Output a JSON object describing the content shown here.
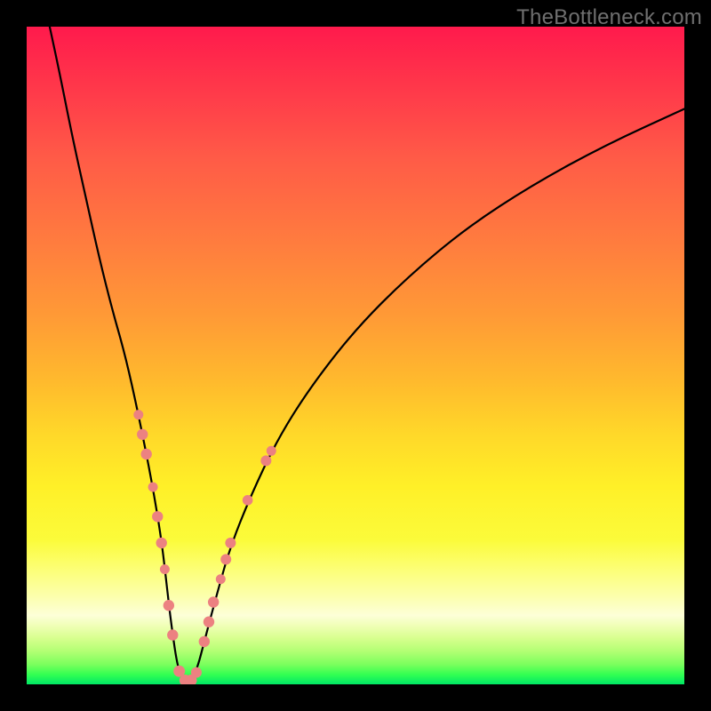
{
  "watermark": "TheBottleneck.com",
  "colors": {
    "frame": "#000000",
    "curve": "#000000",
    "marker_fill": "#ec8181",
    "marker_stroke": "#ec8181"
  },
  "chart_data": {
    "type": "line",
    "title": "",
    "xlabel": "",
    "ylabel": "",
    "xlim": [
      0,
      100
    ],
    "ylim": [
      0,
      100
    ],
    "grid": false,
    "legend": false,
    "series": [
      {
        "name": "bottleneck-curve",
        "x": [
          3.5,
          5,
          7,
          9,
          11,
          13,
          15,
          17,
          19,
          20.5,
          21.3,
          22,
          23,
          24,
          25,
          26,
          27,
          29,
          31,
          34,
          38,
          43,
          50,
          58,
          67,
          77,
          88,
          100
        ],
        "y": [
          100,
          93,
          83,
          74,
          65,
          57,
          50,
          41,
          31,
          22,
          15,
          9,
          2.2,
          0.6,
          0.6,
          2.6,
          6.5,
          14,
          21,
          28.5,
          37,
          45,
          54,
          62,
          69.5,
          76,
          82,
          87.5
        ]
      }
    ],
    "markers": [
      {
        "x": 17.0,
        "y": 41.0,
        "r": 5.5
      },
      {
        "x": 17.6,
        "y": 38.0,
        "r": 6.2
      },
      {
        "x": 18.2,
        "y": 35.0,
        "r": 6.2
      },
      {
        "x": 19.2,
        "y": 30.0,
        "r": 5.5
      },
      {
        "x": 19.9,
        "y": 25.5,
        "r": 6.2
      },
      {
        "x": 20.5,
        "y": 21.5,
        "r": 6.2
      },
      {
        "x": 21.0,
        "y": 17.5,
        "r": 5.5
      },
      {
        "x": 21.6,
        "y": 12.0,
        "r": 6.2
      },
      {
        "x": 22.2,
        "y": 7.5,
        "r": 6.2
      },
      {
        "x": 23.2,
        "y": 2.0,
        "r": 6.5
      },
      {
        "x": 24.1,
        "y": 0.6,
        "r": 6.5
      },
      {
        "x": 25.0,
        "y": 0.6,
        "r": 6.5
      },
      {
        "x": 25.8,
        "y": 1.8,
        "r": 6.0
      },
      {
        "x": 27.0,
        "y": 6.5,
        "r": 6.2
      },
      {
        "x": 27.7,
        "y": 9.5,
        "r": 6.2
      },
      {
        "x": 28.4,
        "y": 12.5,
        "r": 6.2
      },
      {
        "x": 29.5,
        "y": 16.0,
        "r": 5.5
      },
      {
        "x": 30.3,
        "y": 19.0,
        "r": 6.0
      },
      {
        "x": 31.0,
        "y": 21.5,
        "r": 6.0
      },
      {
        "x": 33.6,
        "y": 28.0,
        "r": 5.8
      },
      {
        "x": 36.4,
        "y": 34.0,
        "r": 6.0
      },
      {
        "x": 37.2,
        "y": 35.5,
        "r": 5.5
      }
    ]
  }
}
